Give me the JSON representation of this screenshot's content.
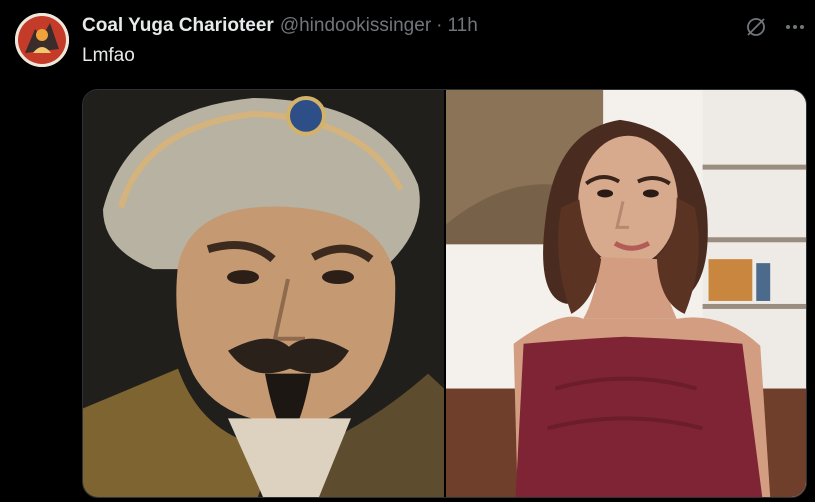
{
  "tweet": {
    "display_name": "Coal Yuga Charioteer",
    "handle": "@hindookissinger",
    "separator": "·",
    "time": "11h",
    "text": "Lmfao"
  },
  "icons": {
    "avatar": "avatar",
    "grok": "grok-icon",
    "more": "more-icon"
  },
  "media": {
    "images": [
      {
        "name": "portrait-emperor-image"
      },
      {
        "name": "portrait-woman-image"
      }
    ]
  },
  "colors": {
    "background": "#000000",
    "primary_text": "#e7e9ea",
    "secondary_text": "#71767b",
    "border": "#2f3336"
  }
}
